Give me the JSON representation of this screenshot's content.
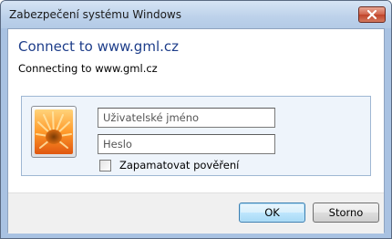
{
  "window": {
    "title": "Zabezpečení systému Windows"
  },
  "dialog": {
    "heading": "Connect to www.gml.cz",
    "subheading": "Connecting to www.gml.cz"
  },
  "credentials": {
    "username_placeholder": "Uživatelské jméno",
    "username_value": "",
    "password_placeholder": "Heslo",
    "password_value": "",
    "remember_label": "Zapamatovat pověření",
    "remember_checked": false
  },
  "buttons": {
    "ok_label": "OK",
    "cancel_label": "Storno"
  },
  "colors": {
    "heading": "#1e3e8a",
    "close_button": "#c0442a",
    "panel_background": "#eef4fb"
  },
  "icons": {
    "close": "close-icon",
    "user_tile": "flower-user-tile-icon"
  }
}
